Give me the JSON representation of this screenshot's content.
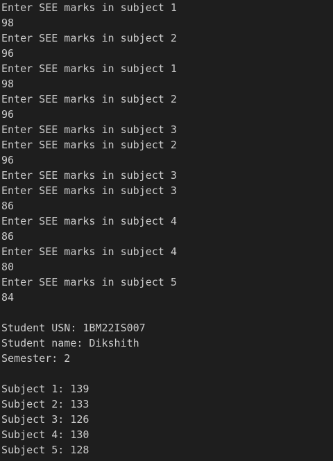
{
  "terminal": {
    "lines": [
      "Enter SEE marks in subject 1",
      "98",
      "Enter SEE marks in subject 2",
      "96",
      "Enter SEE marks in subject 1",
      "98",
      "Enter SEE marks in subject 2",
      "96",
      "Enter SEE marks in subject 3",
      "Enter SEE marks in subject 2",
      "96",
      "Enter SEE marks in subject 3",
      "Enter SEE marks in subject 3",
      "86",
      "Enter SEE marks in subject 4",
      "86",
      "Enter SEE marks in subject 4",
      "80",
      "Enter SEE marks in subject 5",
      "84",
      "",
      "Student USN: 1BM22IS007",
      "Student name: Dikshith",
      "Semester: 2",
      "",
      "Subject 1: 139",
      "Subject 2: 133",
      "Subject 3: 126",
      "Subject 4: 130",
      "Subject 5: 128"
    ]
  },
  "colors": {
    "background": "#1e1e1e",
    "text": "#cccccc"
  }
}
